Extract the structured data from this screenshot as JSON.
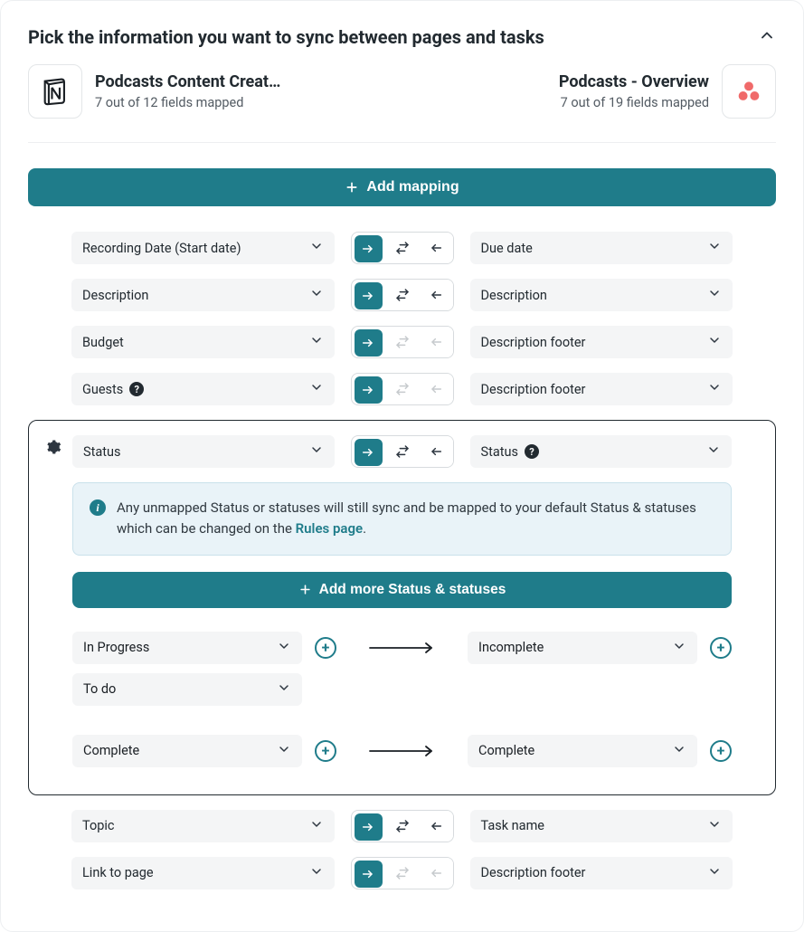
{
  "header": {
    "title": "Pick the information you want to sync between pages and tasks"
  },
  "sources": {
    "left": {
      "name": "Podcasts Content Creat…",
      "sub": "7 out of 12 fields mapped",
      "icon": "notion-icon"
    },
    "right": {
      "name": "Podcasts - Overview",
      "sub": "7 out of 19 fields mapped",
      "icon": "asana-icon"
    }
  },
  "buttons": {
    "add_mapping": "Add mapping",
    "add_status": "Add more Status & statuses"
  },
  "info": {
    "text_a": "Any unmapped Status or statuses will still sync and be mapped to your default Status & statuses which can be changed on the ",
    "link": "Rules page",
    "text_b": "."
  },
  "mappings": [
    {
      "left": "Recording Date (Start date)",
      "right": "Due date",
      "dir": "right",
      "both": true,
      "back": true
    },
    {
      "left": "Description",
      "right": "Description",
      "dir": "right",
      "both": true,
      "back": true
    },
    {
      "left": "Budget",
      "right": "Description footer",
      "dir": "right",
      "both": false,
      "back": false
    },
    {
      "left": "Guests",
      "left_q": true,
      "right": "Description footer",
      "dir": "right",
      "both": false,
      "back": false
    }
  ],
  "status_row": {
    "left": "Status",
    "right": "Status",
    "right_q": true,
    "dir": "right",
    "both": true,
    "back": true
  },
  "status_pairs": [
    {
      "left": [
        "In Progress",
        "To do"
      ],
      "right": "Incomplete"
    },
    {
      "left": [
        "Complete"
      ],
      "right": "Complete"
    }
  ],
  "tail_mappings": [
    {
      "left": "Topic",
      "right": "Task name",
      "dir": "right",
      "both": true,
      "back": true
    },
    {
      "left": "Link to page",
      "right": "Description footer",
      "dir": "right",
      "both": false,
      "back": false
    }
  ]
}
